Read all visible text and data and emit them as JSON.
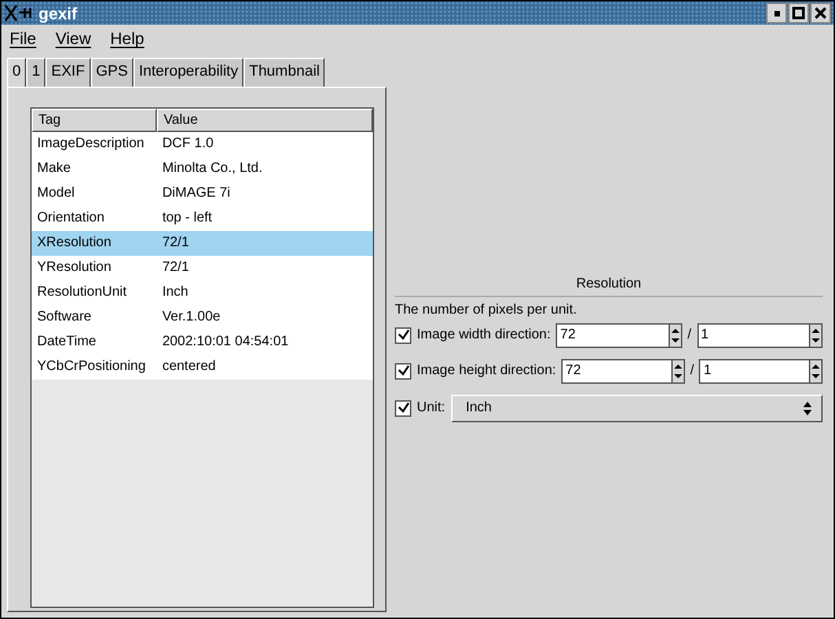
{
  "window": {
    "title": "gexif"
  },
  "menu": [
    "File",
    "View",
    "Help"
  ],
  "tabs": [
    {
      "label": "0",
      "selected": true
    },
    {
      "label": "1",
      "selected": false
    },
    {
      "label": "EXIF",
      "selected": false
    },
    {
      "label": "GPS",
      "selected": false
    },
    {
      "label": "Interoperability",
      "selected": false
    },
    {
      "label": "Thumbnail",
      "selected": false
    }
  ],
  "table": {
    "columns": [
      "Tag",
      "Value"
    ],
    "rows": [
      {
        "tag": "ImageDescription",
        "value": "DCF 1.0",
        "selected": false
      },
      {
        "tag": "Make",
        "value": "Minolta Co., Ltd.",
        "selected": false
      },
      {
        "tag": "Model",
        "value": "DiMAGE 7i",
        "selected": false
      },
      {
        "tag": "Orientation",
        "value": "top - left",
        "selected": false
      },
      {
        "tag": "XResolution",
        "value": "72/1",
        "selected": true
      },
      {
        "tag": "YResolution",
        "value": "72/1",
        "selected": false
      },
      {
        "tag": "ResolutionUnit",
        "value": "Inch",
        "selected": false
      },
      {
        "tag": "Software",
        "value": "Ver.1.00e",
        "selected": false
      },
      {
        "tag": "DateTime",
        "value": "2002:10:01 04:54:01",
        "selected": false
      },
      {
        "tag": "YCbCrPositioning",
        "value": "centered",
        "selected": false
      }
    ]
  },
  "editor": {
    "heading": "Resolution",
    "description": "The number of pixels per unit.",
    "fields": [
      {
        "kind": "ratio",
        "label": "Image width direction:",
        "checked": true,
        "numerator": "72",
        "separator": "/",
        "denominator": "1"
      },
      {
        "kind": "ratio",
        "label": "Image height direction:",
        "checked": true,
        "numerator": "72",
        "separator": "/",
        "denominator": "1"
      },
      {
        "kind": "choice",
        "label": "Unit:",
        "checked": true,
        "value": "Inch"
      }
    ]
  }
}
